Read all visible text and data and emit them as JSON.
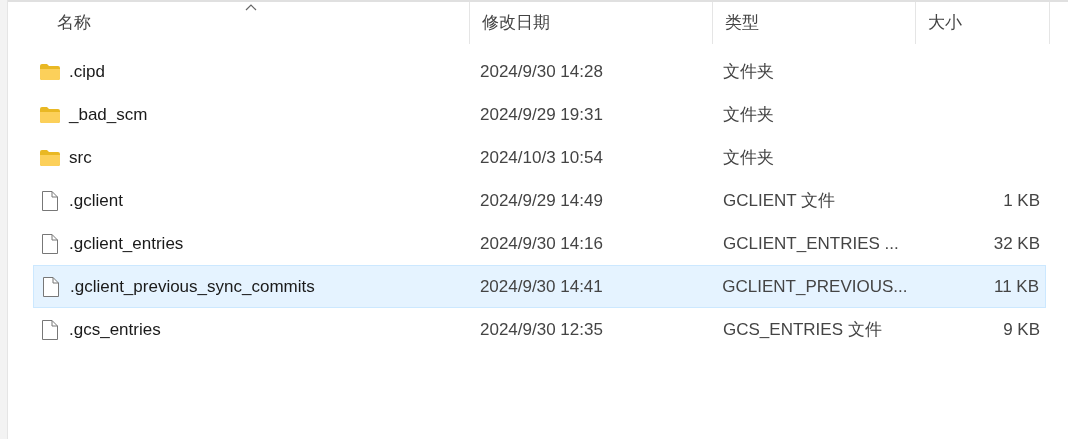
{
  "columns": [
    {
      "label": "名称",
      "sorted": true
    },
    {
      "label": "修改日期",
      "sorted": false
    },
    {
      "label": "类型",
      "sorted": false
    },
    {
      "label": "大小",
      "sorted": false
    }
  ],
  "rows": [
    {
      "kind": "folder",
      "name": ".cipd",
      "date": "2024/9/30 14:28",
      "type": "文件夹",
      "selected": false
    },
    {
      "kind": "folder",
      "name": "_bad_scm",
      "date": "2024/9/29 19:31",
      "type": "文件夹",
      "selected": false
    },
    {
      "kind": "folder",
      "name": "src",
      "date": "2024/10/3 10:54",
      "type": "文件夹",
      "selected": false
    },
    {
      "kind": "file",
      "name": ".gclient",
      "date": "2024/9/29 14:49",
      "type": "GCLIENT 文件",
      "size": "1 KB",
      "selected": false
    },
    {
      "kind": "file",
      "name": ".gclient_entries",
      "date": "2024/9/30 14:16",
      "type": "GCLIENT_ENTRIES ...",
      "size": "32 KB",
      "selected": false
    },
    {
      "kind": "file",
      "name": ".gclient_previous_sync_commits",
      "date": "2024/9/30 14:41",
      "type": "GCLIENT_PREVIOUS...",
      "size": "11 KB",
      "selected": true
    },
    {
      "kind": "file",
      "name": ".gcs_entries",
      "date": "2024/9/30 12:35",
      "type": "GCS_ENTRIES 文件",
      "size": "9 KB",
      "selected": false
    }
  ]
}
